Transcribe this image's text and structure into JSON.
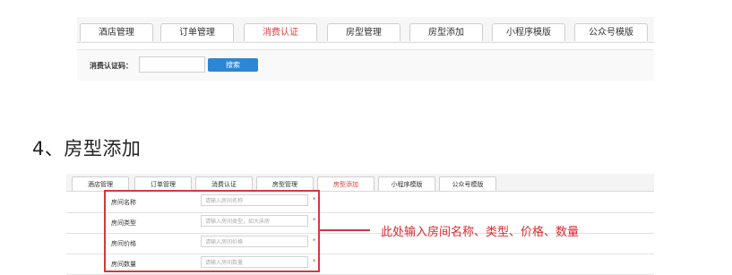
{
  "top_panel": {
    "tabs": [
      {
        "label": "酒店管理",
        "active": false
      },
      {
        "label": "订单管理",
        "active": false
      },
      {
        "label": "消费认证",
        "active": true
      },
      {
        "label": "房型管理",
        "active": false
      },
      {
        "label": "房型添加",
        "active": false
      },
      {
        "label": "小程序模版",
        "active": false
      },
      {
        "label": "公众号模版",
        "active": false
      }
    ],
    "form": {
      "label": "消费认证码：",
      "input_value": "",
      "button_label": "搜索"
    }
  },
  "heading": "4、房型添加",
  "bottom_panel": {
    "tabs": [
      {
        "label": "酒店管理",
        "active": false
      },
      {
        "label": "订单管理",
        "active": false
      },
      {
        "label": "消费认证",
        "active": false
      },
      {
        "label": "房型管理",
        "active": false
      },
      {
        "label": "房型添加",
        "active": true
      },
      {
        "label": "小程序模版",
        "active": false
      },
      {
        "label": "公众号模版",
        "active": false
      }
    ],
    "rows": [
      {
        "label": "房间名称",
        "placeholder": "请输入房间名称",
        "required": "*"
      },
      {
        "label": "房间类型",
        "placeholder": "请输入房间类型，如大床房",
        "required": "*"
      },
      {
        "label": "房间价格",
        "placeholder": "请输入房间价格",
        "required": "*"
      },
      {
        "label": "房间数量",
        "placeholder": "请输入房间数量",
        "required": "*"
      }
    ]
  },
  "annotation": {
    "text": "此处输入房间名称、类型、价格、数量",
    "color": "#e0282e"
  },
  "colors": {
    "active_tab": "#e23a3a",
    "button_bg": "#2b86d3",
    "highlight_border": "#d9363e"
  }
}
